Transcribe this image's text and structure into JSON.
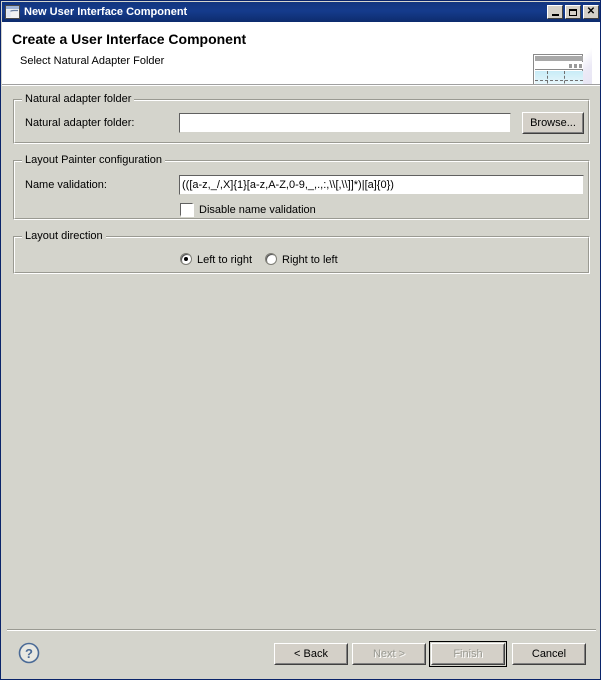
{
  "window": {
    "title": "New User Interface Component",
    "icon": "wizard-window-icon",
    "controls": {
      "minimize": "minimize-button",
      "maximize": "maximize-button",
      "close_label": "✕"
    }
  },
  "header": {
    "title": "Create a User Interface Component",
    "subtitle": "Select Natural Adapter Folder",
    "banner_icon": "layout-preview-icon"
  },
  "groups": {
    "adapter_folder": {
      "legend": "Natural adapter folder",
      "field_label": "Natural adapter folder:",
      "field_value": "",
      "field_placeholder": "",
      "browse_label": "Browse..."
    },
    "layout_painter": {
      "legend": "Layout Painter configuration",
      "field_label": "Name validation:",
      "field_value": "(([a-z,_/,X]{1}[a-z,A-Z,0-9,_,.,:,\\\\[,\\\\]]*)|[a]{0})",
      "checkbox_label": "Disable name validation",
      "checkbox_checked": false
    },
    "layout_direction": {
      "legend": "Layout direction",
      "options": [
        {
          "label": "Left to right",
          "selected": true
        },
        {
          "label": "Right to left",
          "selected": false
        }
      ]
    }
  },
  "footer": {
    "help_icon": "help-question-icon",
    "buttons": [
      {
        "label": "< Back",
        "enabled": true,
        "focused": false
      },
      {
        "label": "Next >",
        "enabled": false,
        "focused": false
      },
      {
        "label": "Finish",
        "enabled": false,
        "focused": true
      },
      {
        "label": "Cancel",
        "enabled": true,
        "focused": false
      }
    ]
  },
  "colors": {
    "titlebar": "#12357f",
    "dialog_bg": "#d4d4cc",
    "header_bg": "#ffffff",
    "field_bg": "#ffffff",
    "disabled_text": "#9a9a92"
  }
}
